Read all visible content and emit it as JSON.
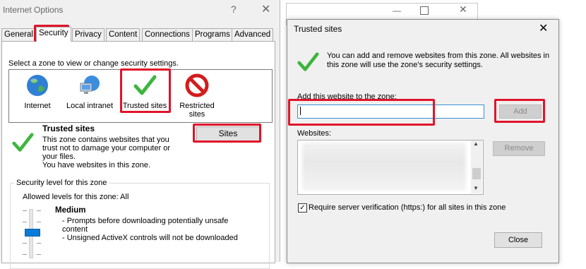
{
  "internet_options": {
    "title": "Internet Options",
    "help_glyph": "?",
    "close_glyph": "✕",
    "tabs": [
      {
        "label": "General"
      },
      {
        "label": "Security"
      },
      {
        "label": "Privacy"
      },
      {
        "label": "Content"
      },
      {
        "label": "Connections"
      },
      {
        "label": "Programs"
      },
      {
        "label": "Advanced"
      }
    ],
    "zone_label": "Select a zone to view or change security settings.",
    "zones": [
      {
        "label": "Internet",
        "icon": "globe-icon"
      },
      {
        "label": "Local intranet",
        "icon": "network-computer-icon"
      },
      {
        "label": "Trusted sites",
        "icon": "checkmark-icon"
      },
      {
        "label": "Restricted sites",
        "icon": "no-entry-icon"
      }
    ],
    "zone_heading": "Trusted sites",
    "zone_description_lines": [
      "This zone contains websites that you",
      "trust not to damage your computer or",
      "your files.",
      "You have websites in this zone."
    ],
    "sites_button": "Sites",
    "security_group_label": "Security level for this zone",
    "allowed_levels": "Allowed levels for this zone: All",
    "level_name": "Medium",
    "level_details": [
      "- Prompts before downloading potentially unsafe",
      "content",
      "- Unsigned ActiveX controls will not be downloaded"
    ]
  },
  "background_window": {
    "min_glyph": "—",
    "close_glyph": "✕"
  },
  "trusted_sites_dialog": {
    "title": "Trusted sites",
    "close_glyph": "✕",
    "info_lines": [
      "You can add and remove websites from this zone. All websites in",
      "this zone will use the zone's security settings."
    ],
    "add_label": "Add this website to the zone:",
    "add_input_value": "",
    "add_button": "Add",
    "websites_label": "Websites:",
    "remove_button": "Remove",
    "require_verification_label": "Require server verification (https:) for all sites in this zone",
    "require_verification_checked": true,
    "close_button": "Close"
  },
  "colors": {
    "highlight": "#e0142a",
    "check_green": "#3db53d",
    "slider_blue": "#0a7bd6"
  }
}
